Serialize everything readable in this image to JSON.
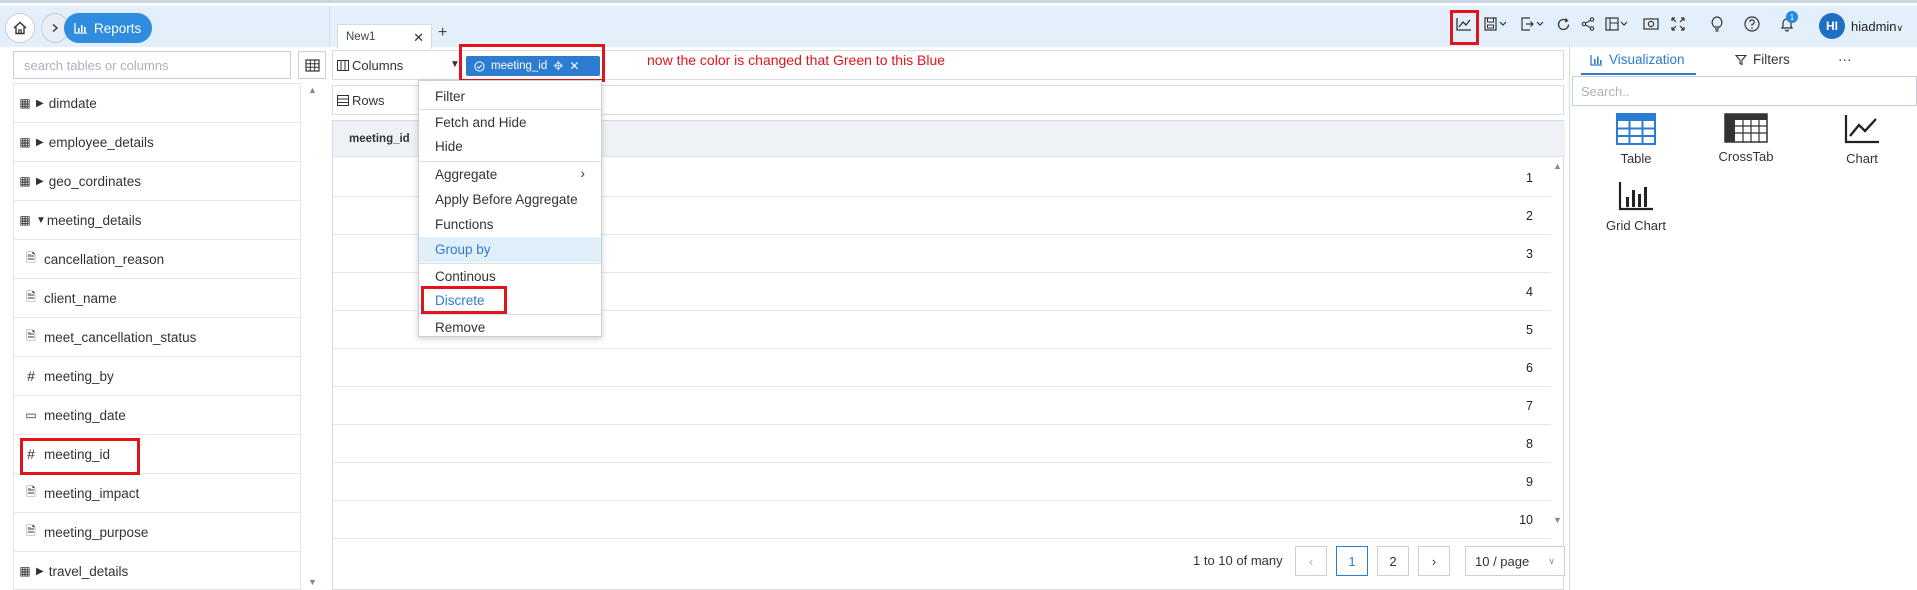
{
  "header": {
    "reports_label": "Reports",
    "tab_name": "New1",
    "user_initials": "HI",
    "username": "hiadmin",
    "notification_count": "1"
  },
  "left_panel": {
    "search_placeholder": "search tables or columns",
    "items": [
      {
        "label": "dimdate",
        "type": "table",
        "state": "collapsed"
      },
      {
        "label": "employee_details",
        "type": "table",
        "state": "collapsed"
      },
      {
        "label": "geo_cordinates",
        "type": "table",
        "state": "collapsed"
      },
      {
        "label": "meeting_details",
        "type": "table",
        "state": "expanded"
      },
      {
        "label": "cancellation_reason",
        "type": "text-column"
      },
      {
        "label": "client_name",
        "type": "text-column"
      },
      {
        "label": "meet_cancellation_status",
        "type": "text-column"
      },
      {
        "label": "meeting_by",
        "type": "number-column"
      },
      {
        "label": "meeting_date",
        "type": "date-column"
      },
      {
        "label": "meeting_id",
        "type": "number-column"
      },
      {
        "label": "meeting_impact",
        "type": "text-column"
      },
      {
        "label": "meeting_purpose",
        "type": "text-column"
      },
      {
        "label": "travel_details",
        "type": "table",
        "state": "collapsed"
      }
    ]
  },
  "shelves": {
    "columns_label": "Columns",
    "rows_label": "Rows",
    "chip_label": "meeting_id",
    "annotation": "now the color is changed that Green to this Blue"
  },
  "context_menu": {
    "items": [
      "Filter",
      "Fetch and Hide",
      "Hide",
      "Aggregate",
      "Apply Before Aggregate",
      "Functions",
      "Group by",
      "Continous",
      "Discrete",
      "Remove"
    ]
  },
  "table": {
    "header": "meeting_id",
    "rows": [
      "1",
      "2",
      "3",
      "4",
      "5",
      "6",
      "7",
      "8",
      "9",
      "10"
    ]
  },
  "pagination": {
    "summary": "1 to 10 of many",
    "pages": [
      "1",
      "2"
    ],
    "page_size": "10 / page"
  },
  "right_panel": {
    "tab_visualization": "Visualization",
    "tab_filters": "Filters",
    "more": "···",
    "search_placeholder": "Search..",
    "viz_items": [
      "Table",
      "CrossTab",
      "Chart",
      "Grid Chart"
    ]
  },
  "colors": {
    "accent_blue": "#2c7cd1",
    "topbar_bg": "#e3f0fb",
    "annotation_red": "#e0151b"
  }
}
